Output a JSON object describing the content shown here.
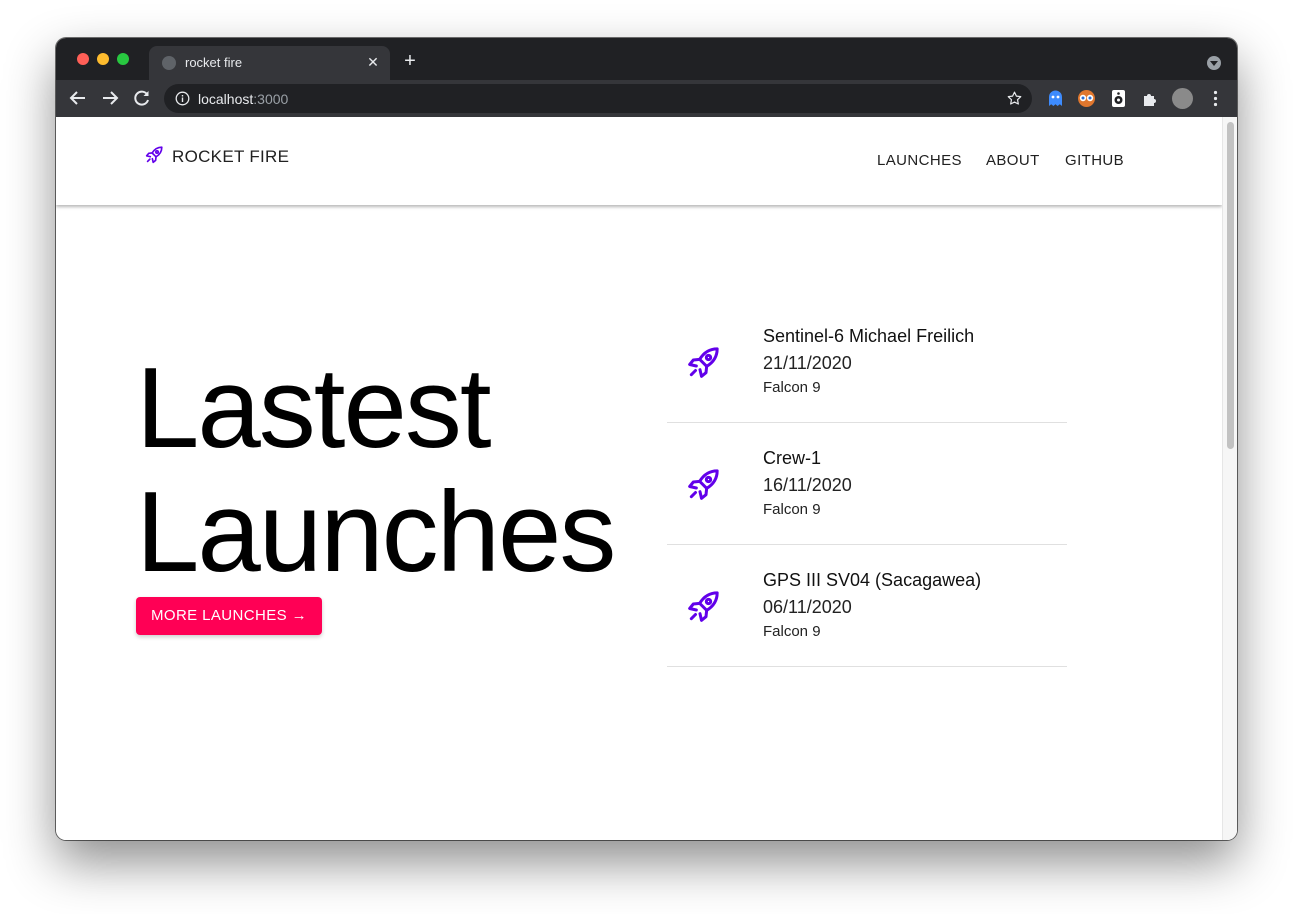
{
  "browser": {
    "tab_title": "rocket fire",
    "tab_close": "✕",
    "new_tab": "+",
    "url_host": "localhost",
    "url_port": ":3000",
    "extension_badge": "0"
  },
  "app": {
    "brand": "ROCKET FIRE",
    "accent_color": "#6200ea",
    "button_color": "#ff0055",
    "nav": [
      "LAUNCHES",
      "ABOUT",
      "GITHUB"
    ]
  },
  "hero": {
    "title_line1": "Lastest",
    "title_line2": "Launches",
    "button_label": "MORE LAUNCHES →"
  },
  "launches": [
    {
      "name": "Sentinel-6 Michael Freilich",
      "date": "21/11/2020",
      "rocket": "Falcon 9",
      "icon": "rocket-icon"
    },
    {
      "name": "Crew-1",
      "date": "16/11/2020",
      "rocket": "Falcon 9",
      "icon": "rocket-icon"
    },
    {
      "name": "GPS III SV04 (Sacagawea)",
      "date": "06/11/2020",
      "rocket": "Falcon 9",
      "icon": "rocket-icon"
    }
  ]
}
